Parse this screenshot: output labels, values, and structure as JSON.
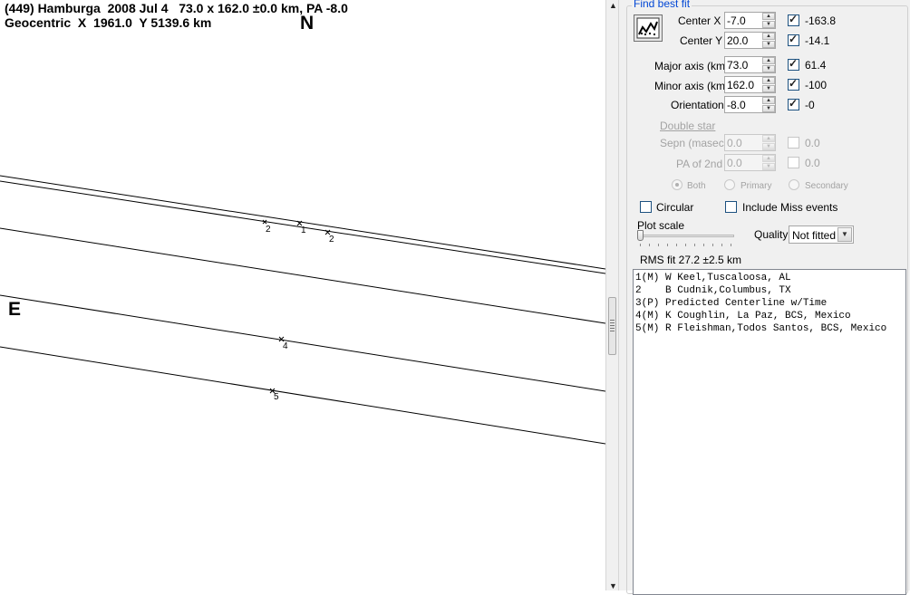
{
  "plot": {
    "header_line1": "(449) Hamburga  2008 Jul 4   73.0 x 162.0 ±0.0 km, PA -8.0",
    "header_line2": "Geocentric  X  1961.0  Y 5139.6 km",
    "north_label": "N",
    "east_label": "E",
    "chord_labels": [
      "2",
      "1",
      "2",
      "4",
      "5"
    ]
  },
  "panel": {
    "group_title": "Find best fit",
    "fit_button_icon": "fit-chart-icon",
    "center_x": {
      "label": "Center X",
      "value": "-7.0",
      "checked": true,
      "result": "-163.8"
    },
    "center_y": {
      "label": "Center Y",
      "value": "20.0",
      "checked": true,
      "result": "-14.1"
    },
    "major_axis": {
      "label": "Major axis (km)",
      "value": "73.0",
      "checked": true,
      "result": "61.4"
    },
    "minor_axis": {
      "label": "Minor axis (km)",
      "value": "162.0",
      "checked": true,
      "result": "-100"
    },
    "orientation": {
      "label": "Orientation",
      "value": "-8.0",
      "checked": true,
      "result": "-0"
    },
    "double_star": {
      "label": "Double star",
      "sepn": {
        "label": "Sepn (masec)",
        "value": "0.0",
        "checked": false,
        "result": "0.0"
      },
      "pa2": {
        "label": "PA of 2nd",
        "value": "0.0",
        "checked": false,
        "result": "0.0"
      },
      "radio_options": [
        "Both",
        "Primary",
        "Secondary"
      ],
      "radio_selected": "Both"
    },
    "circular": {
      "label": "Circular",
      "checked": false
    },
    "include_miss": {
      "label": "Include Miss events",
      "checked": false
    },
    "plot_scale_label": "Plot scale",
    "plot_scale_value": 0,
    "quality_label": "Quality",
    "quality_value": "Not fitted",
    "rms_fit": "RMS fit 27.2 ±2.5 km",
    "observers": [
      "1(M) W Keel,Tuscaloosa, AL",
      "2    B Cudnik,Columbus, TX",
      "3(P) Predicted Centerline w/Time",
      "4(M) K Coughlin, La Paz, BCS, Mexico",
      "5(M) R Fleishman,Todos Santos, BCS, Mexico"
    ]
  },
  "colors": {
    "panel_bg": "#f0f0f0",
    "group_title": "#0046d5",
    "disabled_text": "#a3a3a3"
  }
}
